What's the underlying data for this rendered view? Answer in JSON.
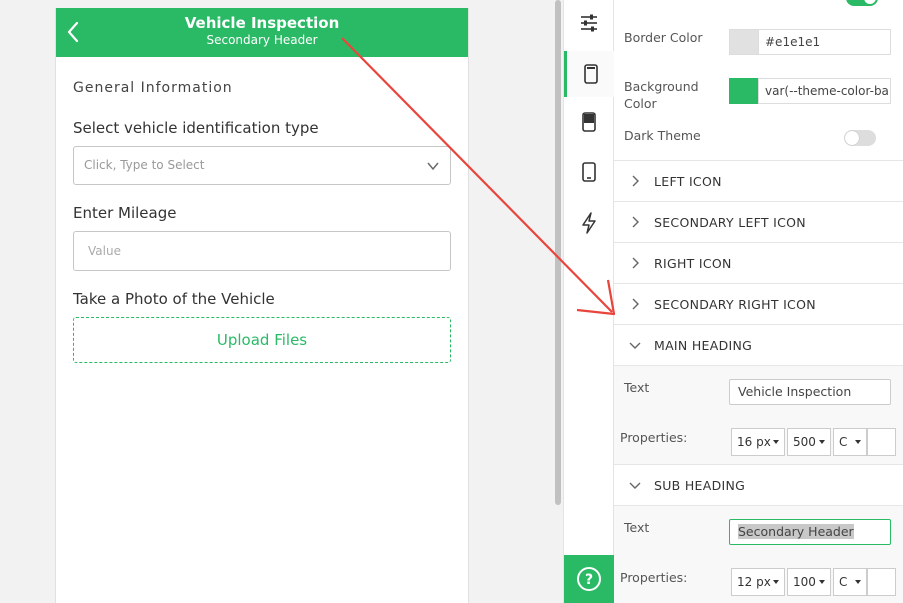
{
  "preview": {
    "header": {
      "title": "Vehicle Inspection",
      "subtitle": "Secondary Header"
    },
    "section_title": "General Information",
    "fields": {
      "vehicle_id_label": "Select vehicle identification type",
      "vehicle_id_placeholder": "Click, Type to Select",
      "mileage_label": "Enter Mileage",
      "mileage_placeholder": "Value",
      "photo_label": "Take a Photo of the Vehicle",
      "upload_label": "Upload Files"
    }
  },
  "rail": {
    "icons": [
      "sliders-icon",
      "phone-screen-icon",
      "phone-header-icon",
      "mobile-icon",
      "lightning-icon"
    ],
    "help": "?"
  },
  "panel": {
    "border_color": {
      "label": "Border Color",
      "value": "#e1e1e1",
      "swatch": "#e1e1e1"
    },
    "background_color": {
      "label": "Background Color",
      "value": "var(--theme-color-ba",
      "swatch": "#2aba66"
    },
    "dark_theme": {
      "label": "Dark Theme",
      "on": false
    },
    "sections": {
      "left_icon": "LEFT ICON",
      "secondary_left_icon": "SECONDARY LEFT ICON",
      "right_icon": "RIGHT ICON",
      "secondary_right_icon": "SECONDARY RIGHT ICON",
      "main_heading": "MAIN HEADING",
      "sub_heading": "SUB HEADING"
    },
    "main_heading": {
      "text_label": "Text",
      "text_value": "Vehicle Inspection",
      "properties_label": "Properties:",
      "size": "16 px",
      "weight": "500",
      "align": "C"
    },
    "sub_heading": {
      "text_label": "Text",
      "text_value": "Secondary Header",
      "properties_label": "Properties:",
      "size": "12 px",
      "weight": "100",
      "align": "C"
    }
  },
  "colors": {
    "accent": "#2aba66",
    "arrow": "#e8453c"
  }
}
